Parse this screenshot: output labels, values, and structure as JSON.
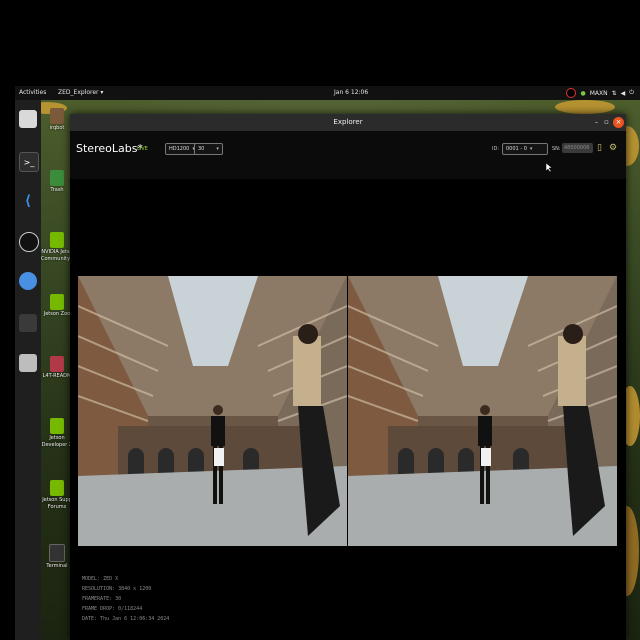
{
  "topbar": {
    "activities": "Activities",
    "app_menu": "ZED_Explorer ▾",
    "clock": "Jan 6 12:06",
    "power_mode": "MAXN"
  },
  "dock": {
    "items": [
      "files-icon",
      "terminal-icon",
      "vscode-icon",
      "obs-icon",
      "chromium-icon",
      "app-grid-icon",
      "drive-icon"
    ]
  },
  "desktop_icons": [
    {
      "label": "irqbot",
      "icon": "folder-icon"
    },
    {
      "label": "Trash",
      "icon": "trash-icon"
    },
    {
      "label": "NVIDIA Jetso\nCommunity F",
      "icon": "nvidia-icon"
    },
    {
      "label": "Jetson Zoo",
      "icon": "nvidia-icon"
    },
    {
      "label": "L4T-READM",
      "icon": "folder-icon"
    },
    {
      "label": "Jetson\nDeveloper Z",
      "icon": "nvidia-icon"
    },
    {
      "label": "Jetson Supp\nForums",
      "icon": "nvidia-icon"
    },
    {
      "label": "Terminal",
      "icon": "terminal-icon"
    }
  ],
  "window": {
    "title": "Explorer",
    "brand": "StereoLabs*",
    "live": "LIVE",
    "resolution_select": "HD1200",
    "fps_select": "30",
    "id_label": "ID:",
    "id_select": "0001 - 0",
    "sn_label": "SN:",
    "sn_value": "48000006"
  },
  "info": {
    "model": "MODEL: ZED X",
    "resolution": "RESOLUTION: 3840 x 1200",
    "framerate": "FRAMERATE: 30",
    "frame_drop": "FRAME DROP: 0/118244",
    "date": "DATE: Thu Jan 6 12:06:34 2024"
  },
  "colors": {
    "accent_live": "#9fd33a",
    "topbar": "#111111",
    "titlebar": "#2b2b2b",
    "close_button": "#e95420"
  }
}
